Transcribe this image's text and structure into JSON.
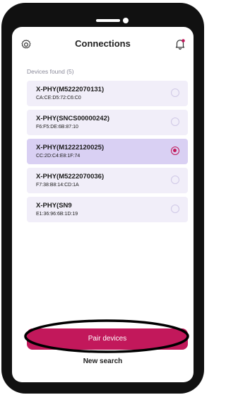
{
  "header": {
    "title": "Connections",
    "settings_icon": "gear-icon",
    "notifications_icon": "bell-icon"
  },
  "devices_found_label": "Devices found (5)",
  "devices": [
    {
      "name": "X-PHY(M5222070131)",
      "mac": "CA:CE:D5:72:C6:C0",
      "selected": false
    },
    {
      "name": "X-PHY(SNCS00000242)",
      "mac": "F6:F5:DE:6B:87:10",
      "selected": false
    },
    {
      "name": "X-PHY(M1222120025)",
      "mac": "CC:2D:C4:E8:1F:74",
      "selected": true
    },
    {
      "name": "X-PHY(M5222070036)",
      "mac": "F7:38:B8:14:CD:1A",
      "selected": false
    },
    {
      "name": "X-PHY(SN9",
      "mac": "E1:36:96:6B:1D:19",
      "selected": false
    }
  ],
  "actions": {
    "pair_label": "Pair devices",
    "new_search_label": "New search"
  },
  "colors": {
    "accent": "#c2185b",
    "card_bg": "#f1eef9",
    "card_selected_bg": "#d9d0f3",
    "frame": "#111111"
  }
}
